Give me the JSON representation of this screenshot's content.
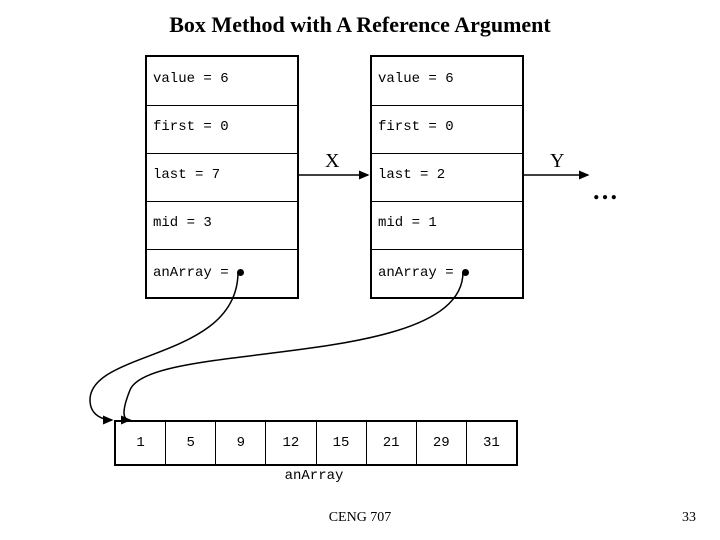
{
  "title": "Box Method with A Reference Argument",
  "boxA": {
    "value": "value = 6",
    "first": "first = 0",
    "last": "last = 7",
    "mid": "mid = 3",
    "ptr": "anArray ="
  },
  "boxB": {
    "value": "value = 6",
    "first": "first = 0",
    "last": "last = 2",
    "mid": "mid = 1",
    "ptr": "anArray ="
  },
  "labels": {
    "x": "X",
    "y": "Y",
    "ellipsis": "…",
    "arrayName": "anArray"
  },
  "array": [
    "1",
    "5",
    "9",
    "12",
    "15",
    "21",
    "29",
    "31"
  ],
  "footer": {
    "course": "CENG 707",
    "page": "33"
  }
}
